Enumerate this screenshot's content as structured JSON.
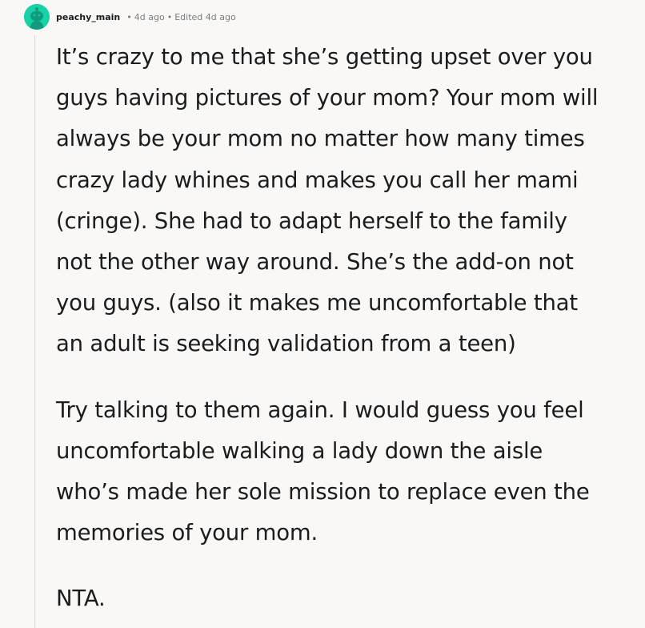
{
  "comment": {
    "author": "peachy_main",
    "separator": "•",
    "posted": "4d ago",
    "edited": "Edited 4d ago",
    "avatar_icon": "reddit-snoo-avatar-icon",
    "avatar_color": "#18d1a7",
    "paragraphs": [
      [
        "It’s crazy to me that she’s getting upset over you",
        "guys having pictures of your mom? Your mom will",
        "always be your mom no matter how many times",
        "crazy lady whines and makes you call her mami",
        "(cringe). She had to adapt herself to the family",
        "not the other way around. She’s the add-on not",
        "you guys. (also it makes me uncomfortable that",
        "an adult is seeking validation from a teen)"
      ],
      [
        "Try talking to them again. I would guess you feel",
        "uncomfortable walking a lady down the aisle",
        "who’s made her sole mission to replace even the",
        "memories of your mom."
      ],
      [
        "NTA."
      ]
    ]
  }
}
